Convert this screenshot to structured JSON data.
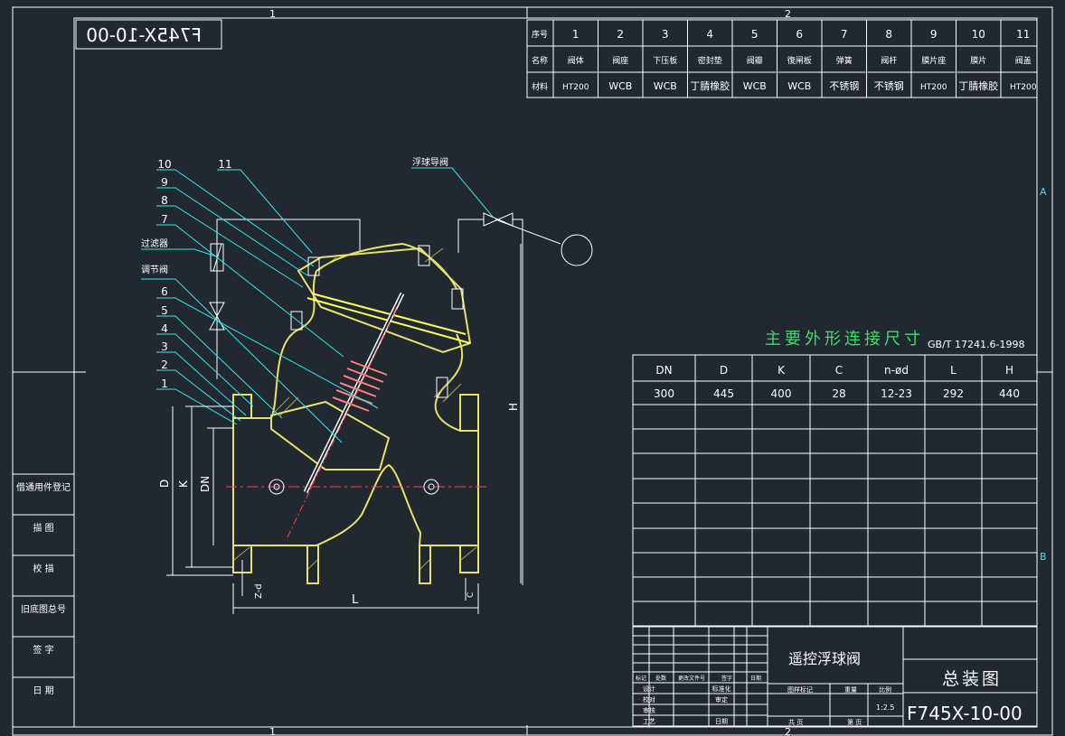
{
  "frame": {
    "zone_top_1": "1",
    "zone_top_2": "2",
    "zone_bottom_1": "1",
    "zone_bottom_2": "2",
    "zone_right_a": "A",
    "zone_right_b": "B",
    "drawing_code_mirrored": "F745X-10-00"
  },
  "parts_table": {
    "row_headers": [
      "序号",
      "名称",
      "材料"
    ],
    "numbers": [
      "1",
      "2",
      "3",
      "4",
      "5",
      "6",
      "7",
      "8",
      "9",
      "10",
      "11"
    ],
    "names": [
      "阀体",
      "阀座",
      "下压板",
      "密封垫",
      "阀瓣",
      "復闸板",
      "弹簧",
      "阀杆",
      "膜片座",
      "膜片",
      "阀盖"
    ],
    "materials": [
      "HT200",
      "WCB",
      "WCB",
      "丁腈橡胶",
      "WCB",
      "WCB",
      "不锈钢",
      "不锈钢",
      "HT200",
      "丁腈橡胶",
      "HT200"
    ]
  },
  "side_panel": [
    "借通用件登记",
    "描 图",
    "校 描",
    "旧底图总号",
    "签 字",
    "日 期"
  ],
  "callouts": {
    "left_numbers": [
      "10",
      "9",
      "8",
      "7",
      "6",
      "5",
      "4",
      "3",
      "2",
      "1"
    ],
    "top_number": "11",
    "filter": "过滤器",
    "regulating_valve": "调节阀",
    "float_pilot_valve": "浮球导阀"
  },
  "dimension_labels": {
    "H": "H",
    "D": "D",
    "K": "K",
    "DN": "DN",
    "L": "L",
    "Z": "Z-d",
    "C": "C"
  },
  "dims_table": {
    "title": "主要外形连接尺寸",
    "standard": "GB/T 17241.6-1998",
    "headers": [
      "DN",
      "D",
      "K",
      "C",
      "n-ød",
      "L",
      "H"
    ],
    "values": [
      "300",
      "445",
      "400",
      "28",
      "12-23",
      "292",
      "440"
    ]
  },
  "title_block": {
    "rev_headers": [
      "标记",
      "处数",
      "更改文件号",
      "签字",
      "日期"
    ],
    "left_rows": [
      "设计",
      "校对",
      "审核",
      "工艺"
    ],
    "mid_rows": [
      "标准化",
      "审定"
    ],
    "bottom_mid": [
      "日期"
    ],
    "product_name": "遥控浮球阀",
    "drawing_type": "总装图",
    "drawing_code": "F745X-10-00",
    "stage_label": "图样标记",
    "weight_label": "重量",
    "scale_label": "比例",
    "scale_value": "1:2.5",
    "sheets_total": "共 页",
    "sheet_no": "第 页"
  }
}
